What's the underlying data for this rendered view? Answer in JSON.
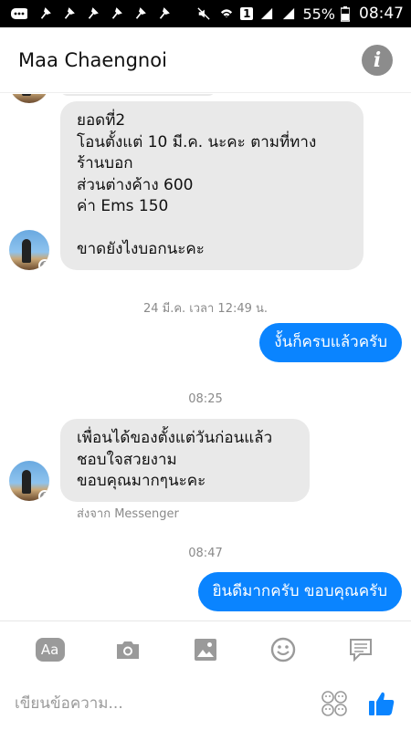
{
  "status_bar": {
    "battery_percent": "55%",
    "time": "08:47",
    "sim_badge": "1"
  },
  "header": {
    "title": "Maa Chaengnoi",
    "info_icon": "info-icon"
  },
  "thread": {
    "incoming_1": {
      "lines": [
        "ยอดที่2",
        "โอนตั้งแต่ 10 มี.ค. นะคะ ตามที่ทาง",
        "ร้านบอก",
        "ส่วนต่างค้าง 600",
        "ค่า Ems 150",
        "",
        "ขาดยังไงบอกนะคะ"
      ]
    },
    "timestamp_1": "24 มี.ค. เวลา 12:49 น.",
    "outgoing_1": "งั้นก็ครบแล้วครับ",
    "timestamp_2": "08:25",
    "incoming_2": {
      "lines": [
        "เพื่อนได้ของตั้งแต่วันก่อนแล้ว",
        "ชอบใจสวยงาม",
        "ขอบคุณมากๆนะคะ"
      ]
    },
    "sent_via": "ส่งจาก Messenger",
    "timestamp_3": "08:47",
    "outgoing_2": "ยินดีมากครับ ขอบคุณครับ"
  },
  "toolbar": {
    "text_button_label": "Aa",
    "icons": [
      "camera-icon",
      "image-icon",
      "emoji-icon",
      "sticker-icon"
    ]
  },
  "composer": {
    "placeholder": "เขียนข้อความ...",
    "value": ""
  },
  "colors": {
    "accent": "#0a84ff",
    "incoming_bubble": "#e9e9e9",
    "muted_text": "#8a8a8a"
  }
}
